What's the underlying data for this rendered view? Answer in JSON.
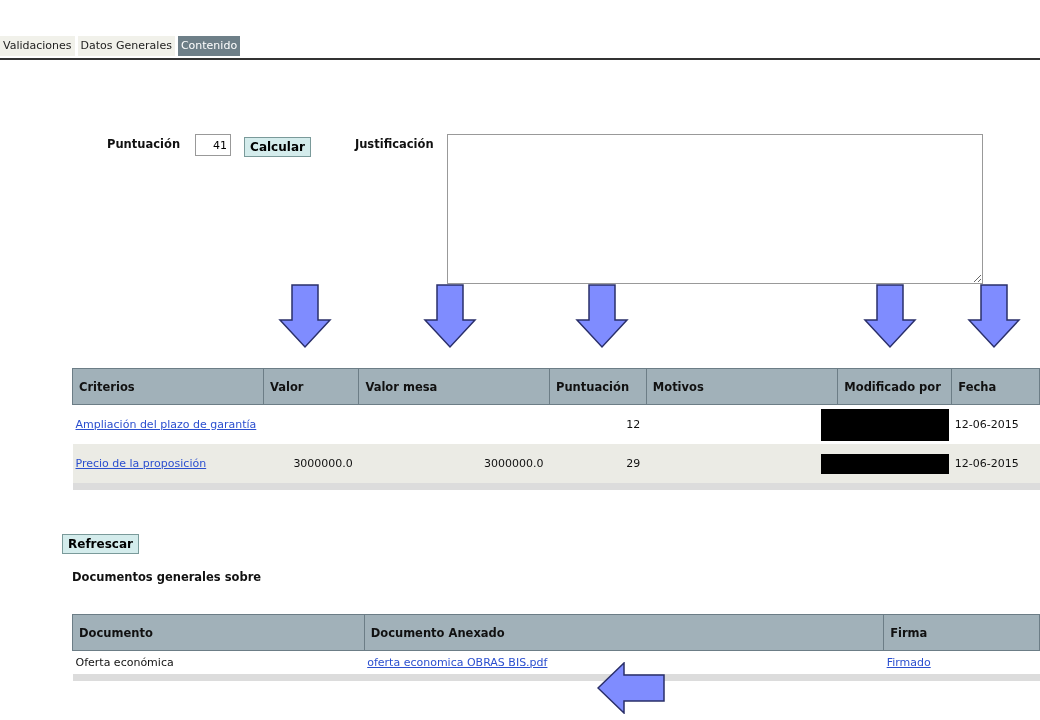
{
  "tabs": [
    {
      "label": "Validaciones",
      "selected": false
    },
    {
      "label": "Datos Generales",
      "selected": false
    },
    {
      "label": "Contenido",
      "selected": true
    }
  ],
  "score_form": {
    "label": "Puntuación",
    "value": "41",
    "button": "Calcular",
    "justification_label": "Justificación"
  },
  "criteria_table": {
    "columns": [
      "Criterios",
      "Valor",
      "Valor mesa",
      "Puntuación",
      "Motivos",
      "Modificado por",
      "Fecha"
    ],
    "rows": [
      {
        "criterio": "Ampliación del plazo de garantía",
        "puntuacion": "12",
        "redacted": true,
        "fecha": "12-06-2015"
      },
      {
        "criterio": "Precio de la proposición",
        "valor": "3000000.0",
        "valor_mesa": "3000000.0",
        "puntuacion": "29",
        "redacted": true,
        "fecha": "12-06-2015"
      }
    ]
  },
  "refresh_button": "Refrescar",
  "documents_heading": "Documentos generales sobre",
  "documents_table": {
    "columns": [
      "Documento",
      "Documento Anexado",
      "Firma"
    ],
    "rows": [
      {
        "documento": "Oferta económica",
        "anexo": "oferta economica OBRAS BIS.pdf",
        "firma": "Firmado"
      }
    ]
  }
}
